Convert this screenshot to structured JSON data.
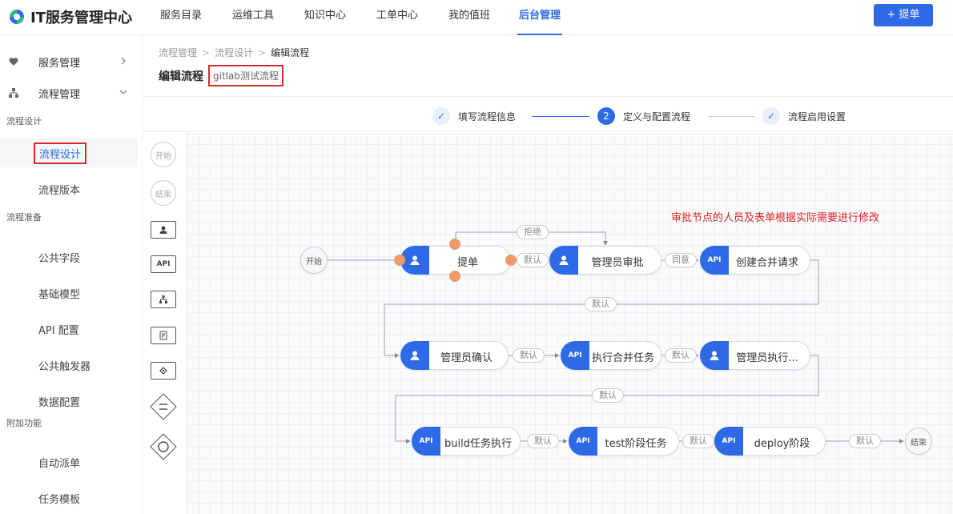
{
  "app": {
    "title": "IT服务管理中心"
  },
  "nav": {
    "items": [
      "服务目录",
      "运维工具",
      "知识中心",
      "工单中心",
      "我的值班",
      "后台管理"
    ],
    "active": "后台管理",
    "submit_label": "+ 提单"
  },
  "sidebar": {
    "groups": [
      {
        "label": "服务管理",
        "icon": "heart-icon"
      },
      {
        "label": "流程管理",
        "icon": "org-tree-icon"
      }
    ],
    "categories": [
      "流程设计",
      "流程准备",
      "附加功能"
    ],
    "items": [
      "流程设计",
      "流程版本",
      "公共字段",
      "基础模型",
      "API 配置",
      "公共触发器",
      "数据配置",
      "自动派单",
      "任务模板"
    ],
    "active": "流程设计"
  },
  "breadcrumb": [
    "流程管理",
    "流程设计",
    "编辑流程"
  ],
  "page": {
    "title": "编辑流程",
    "subtitle": "gitlab测试流程"
  },
  "steps": [
    {
      "label": "填写流程信息",
      "state": "done"
    },
    {
      "label": "定义与配置流程",
      "state": "current",
      "number": "2"
    },
    {
      "label": "流程启用设置",
      "state": "done"
    }
  ],
  "palette": {
    "start": "开始",
    "end": "结束",
    "api": "API"
  },
  "canvas": {
    "note": "审批节点的人员及表单根据实际需要进行修改",
    "start_label": "开始",
    "end_label": "结束",
    "api_tag": "API",
    "nodes": [
      {
        "label": "提单",
        "type": "user"
      },
      {
        "label": "管理员审批",
        "type": "user"
      },
      {
        "label": "创建合并请求",
        "type": "api"
      },
      {
        "label": "管理员确认",
        "type": "user"
      },
      {
        "label": "执行合并任务",
        "type": "api"
      },
      {
        "label": "管理员执行...",
        "type": "user"
      },
      {
        "label": "build任务执行",
        "type": "api"
      },
      {
        "label": "test阶段任务",
        "type": "api"
      },
      {
        "label": "deploy阶段",
        "type": "api"
      }
    ],
    "edge_labels": {
      "reject": "拒绝",
      "default": "默认",
      "agree": "同意"
    }
  }
}
